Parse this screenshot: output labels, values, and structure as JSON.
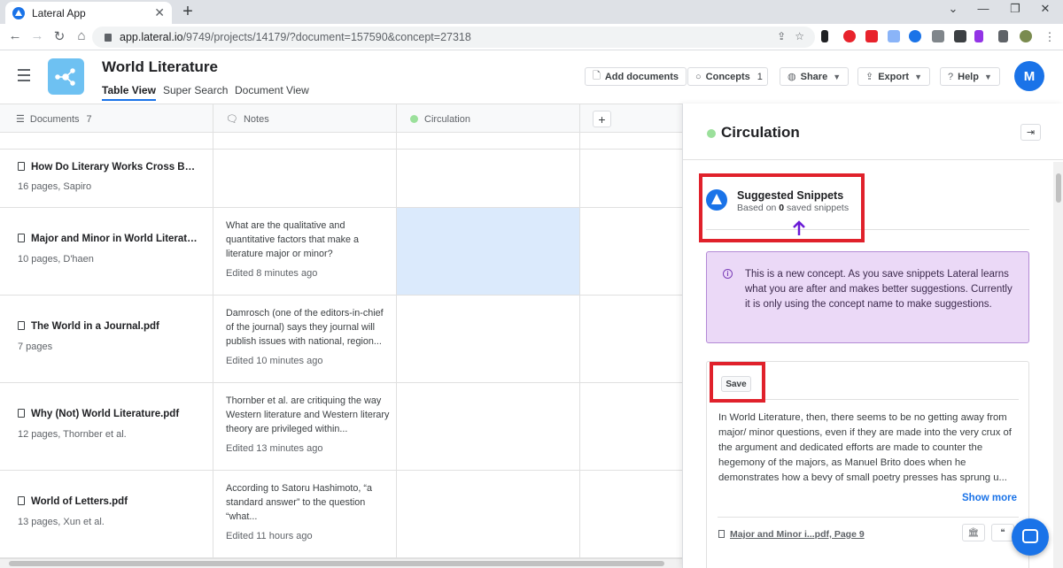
{
  "browser": {
    "tab_title": "Lateral App",
    "url_host": "app.lateral.io",
    "url_path": "/9749/projects/14179/?document=157590&concept=27318"
  },
  "app": {
    "title": "World Literature",
    "views": [
      "Table View",
      "Super Search",
      "Document View"
    ],
    "buttons": {
      "add_documents": "Add documents",
      "concepts": "Concepts",
      "concepts_count": "1",
      "share": "Share",
      "export": "Export",
      "help": "Help"
    },
    "avatar_initial": "M"
  },
  "table": {
    "columns": {
      "documents": "Documents",
      "documents_count": "7",
      "notes": "Notes",
      "circulation": "Circulation"
    },
    "rows": [
      {
        "title": "How Do Literary Works Cross Bor...",
        "meta": "16 pages, Sapiro",
        "note": "",
        "edited": ""
      },
      {
        "title": "Major and Minor in World Literatu...",
        "meta": "10 pages, D'haen",
        "note": "What are the qualitative and quantitative factors that make a literature major or minor?",
        "edited": "Edited 8 minutes ago"
      },
      {
        "title": "The World in a Journal.pdf",
        "meta": "7 pages",
        "note": "Damrosch (one of the editors-in-chief of the journal) says they journal will publish issues with national, region...",
        "edited": "Edited 10 minutes ago"
      },
      {
        "title": "Why (Not) World Literature.pdf",
        "meta": "12 pages, Thornber et al.",
        "note": "Thornber et al. are critiquing the way Western literature and Western literary theory are privileged within...",
        "edited": "Edited 13 minutes ago"
      },
      {
        "title": "World of Letters.pdf",
        "meta": "13 pages, Xun et al.",
        "note": "According to Satoru Hashimoto, “a standard answer” to the question “what...",
        "edited": "Edited 11 hours ago"
      }
    ]
  },
  "panel": {
    "title": "Circulation",
    "snippets": {
      "title": "Suggested Snippets",
      "subtitle_prefix": "Based on ",
      "saved_count": "0",
      "subtitle_suffix": " saved snippets"
    },
    "info": "This is a new concept. As you save snippets Lateral learns what you are after and makes better suggestions. Currently it is only using the concept name to make suggestions.",
    "card": {
      "save_label": "Save",
      "text": "In World Literature, then, there seems to be no getting away from major/ minor questions, even if they are made into the very crux of the argument and dedicated efforts are made to counter the hegemony of the majors, as Manuel Brito does when he demonstrates how a bevy of small poetry presses has sprung u...",
      "show_more": "Show more",
      "source": "Major and Minor i...pdf, Page 9"
    }
  },
  "colors": {
    "accent": "#1a73e8",
    "concept_dot": "#9be09b",
    "highlight_red": "#e0212b",
    "info_bg": "#ebd9f7",
    "arrow": "#6a1bd6"
  },
  "icons": [
    "back-icon",
    "forward-icon",
    "reload-icon",
    "home-icon",
    "lock-icon",
    "share-page-icon",
    "star-icon",
    "extension-icon",
    "hamburger-icon",
    "document-icon",
    "notes-icon",
    "plus-icon",
    "info-icon",
    "collapse-panel-icon",
    "chat-icon"
  ]
}
